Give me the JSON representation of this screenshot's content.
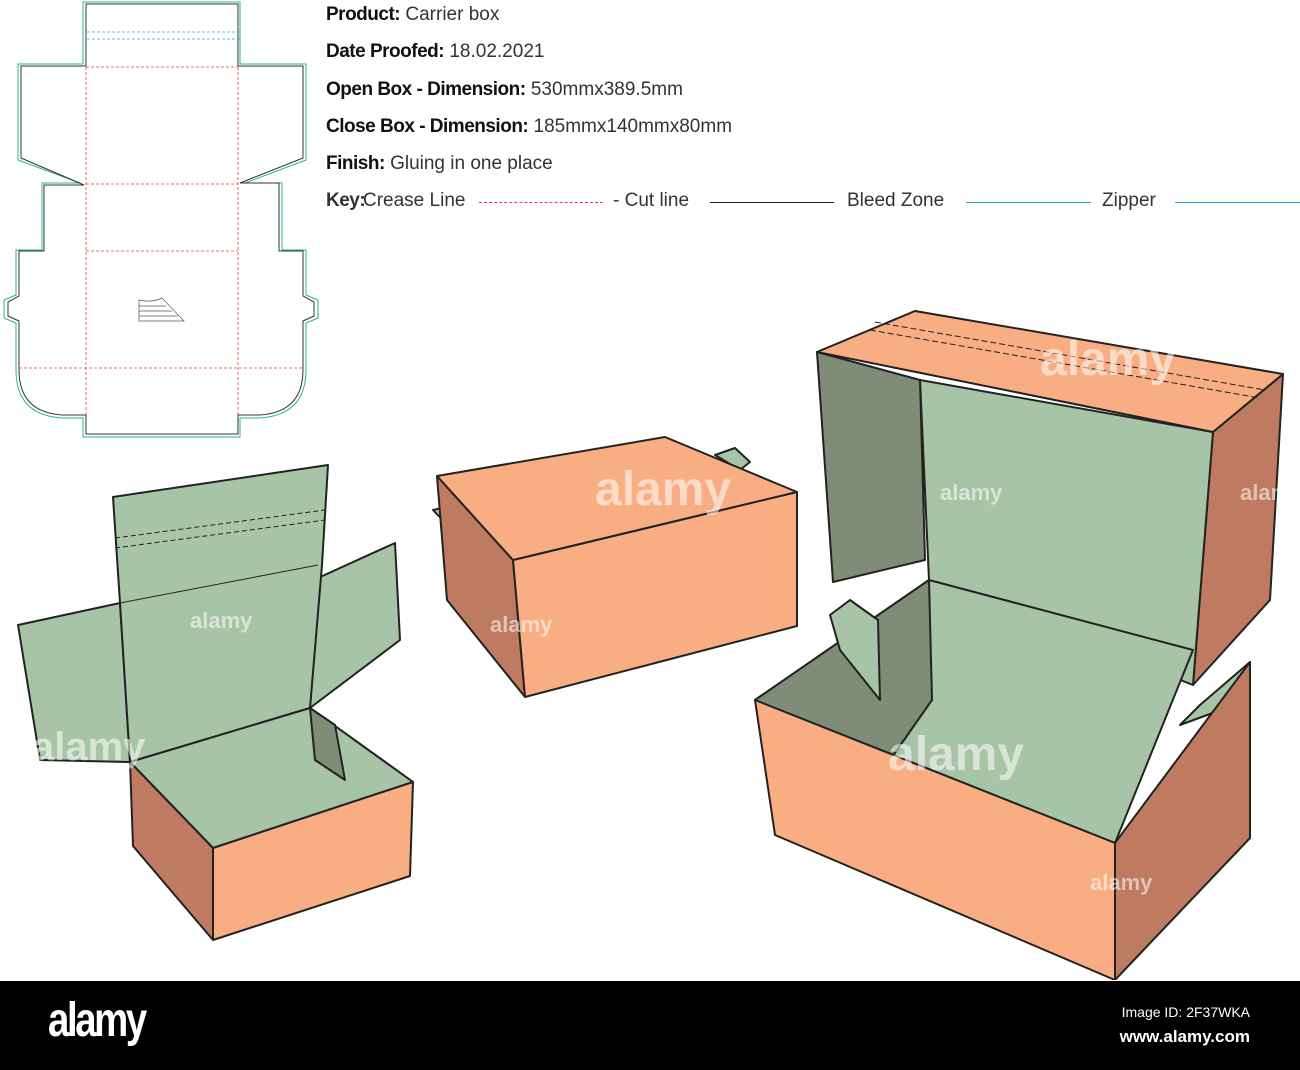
{
  "specs": {
    "product_label": "Product:",
    "product_value": "Carrier box",
    "date_label": "Date Proofed:",
    "date_value": "18.02.2021",
    "open_label": "Open Box - Dimension:",
    "open_value": "530mmx389.5mm",
    "close_label": "Close Box - Dimension:",
    "close_value": "185mmx140mmx80mm",
    "finish_label": "Finish:",
    "finish_value": "Gluing in one place"
  },
  "key": {
    "label": "Key:",
    "items": [
      {
        "text": "Crease Line",
        "color": "#e0413f"
      },
      {
        "text": "- Cut line",
        "color": "#222222"
      },
      {
        "text": "Bleed Zone",
        "color": "#2bb58a"
      },
      {
        "text": "Zipper",
        "color": "#27a9e1"
      }
    ]
  },
  "colors": {
    "orange": "#f8ae82",
    "orange_dark": "#bf7b62",
    "green": "#a7c4a6",
    "green_dark": "#7f8c78"
  },
  "watermark": "alamy",
  "footer": {
    "logo": "alamy",
    "image_id": "Image ID: 2F37WKA",
    "site": "www.alamy.com"
  }
}
